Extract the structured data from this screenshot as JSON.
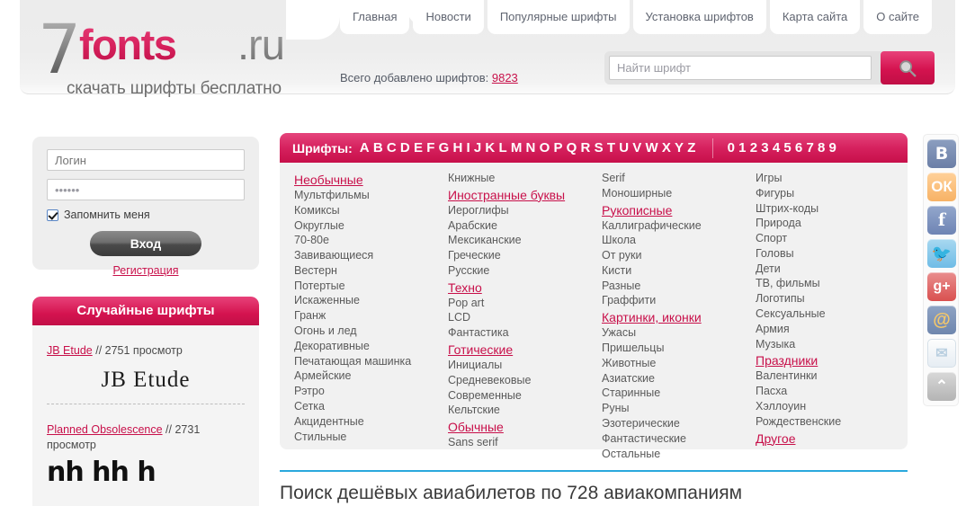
{
  "site": {
    "logo_seven": "7",
    "logo_fonts": "fonts",
    "logo_ru": ".ru",
    "tagline": "скачать шрифты бесплатно"
  },
  "nav": {
    "items": [
      {
        "label": "Главная"
      },
      {
        "label": "Новости"
      },
      {
        "label": "Популярные шрифты"
      },
      {
        "label": "Установка шрифтов"
      },
      {
        "label": "Карта сайта"
      },
      {
        "label": "О сайте"
      }
    ]
  },
  "counter": {
    "label": "Всего добавлено шрифтов:",
    "value": "9823"
  },
  "search": {
    "placeholder": "Найти шрифт",
    "value": "",
    "icon": "search-icon"
  },
  "login": {
    "username_placeholder": "Логин",
    "username_value": "",
    "password_value": "••••••",
    "remember_label": "Запомнить меня",
    "remember_checked": true,
    "submit_label": "Вход",
    "register_label": "Регистрация"
  },
  "random_fonts": {
    "title": "Случайные шрифты",
    "items": [
      {
        "name": "JB Etude",
        "sep": "//",
        "views": "2751 просмотр",
        "preview": "JB Etude"
      },
      {
        "name": "Planned Obsolescence",
        "sep": "//",
        "views": "2731 просмотр",
        "preview": "nh hh h"
      }
    ]
  },
  "alphabet_bar": {
    "label": "Шрифты:",
    "letters": [
      "A",
      "B",
      "C",
      "D",
      "E",
      "F",
      "G",
      "H",
      "I",
      "J",
      "K",
      "L",
      "M",
      "N",
      "O",
      "P",
      "Q",
      "R",
      "S",
      "T",
      "U",
      "V",
      "W",
      "X",
      "Y",
      "Z"
    ],
    "digits": [
      "0",
      "1",
      "2",
      "3",
      "4",
      "5",
      "6",
      "7",
      "8",
      "9"
    ]
  },
  "categories": {
    "columns": [
      {
        "items": [
          {
            "label": "Необычные",
            "head": true
          },
          {
            "label": "Мультфильмы",
            "head": false
          },
          {
            "label": "Комиксы",
            "head": false
          },
          {
            "label": "Округлые",
            "head": false
          },
          {
            "label": "70-80е",
            "head": false
          },
          {
            "label": "Завивающиеся",
            "head": false
          },
          {
            "label": "Вестерн",
            "head": false
          },
          {
            "label": "Потертые",
            "head": false
          },
          {
            "label": "Искаженные",
            "head": false
          },
          {
            "label": "Гранж",
            "head": false
          },
          {
            "label": "Огонь и лед",
            "head": false
          },
          {
            "label": "Декоративные",
            "head": false
          },
          {
            "label": "Печатающая машинка",
            "head": false
          },
          {
            "label": "Армейские",
            "head": false
          },
          {
            "label": "Рэтро",
            "head": false
          },
          {
            "label": "Сетка",
            "head": false
          },
          {
            "label": "Акцидентные",
            "head": false
          },
          {
            "label": "Стильные",
            "head": false
          }
        ]
      },
      {
        "items": [
          {
            "label": "Книжные",
            "head": false
          },
          {
            "label": "Иностранные буквы",
            "head": true
          },
          {
            "label": "Иероглифы",
            "head": false
          },
          {
            "label": "Арабские",
            "head": false
          },
          {
            "label": "Мексиканские",
            "head": false
          },
          {
            "label": "Греческие",
            "head": false
          },
          {
            "label": "Русские",
            "head": false
          },
          {
            "label": "Техно",
            "head": true
          },
          {
            "label": "Pop art",
            "head": false
          },
          {
            "label": "LCD",
            "head": false
          },
          {
            "label": "Фантастика",
            "head": false
          },
          {
            "label": "Готические",
            "head": true
          },
          {
            "label": "Инициалы",
            "head": false
          },
          {
            "label": "Средневековые",
            "head": false
          },
          {
            "label": "Современные",
            "head": false
          },
          {
            "label": "Кельтские",
            "head": false
          },
          {
            "label": "Обычные",
            "head": true
          },
          {
            "label": "Sans serif",
            "head": false
          }
        ]
      },
      {
        "items": [
          {
            "label": "Serif",
            "head": false
          },
          {
            "label": "Моноширные",
            "head": false
          },
          {
            "label": "Рукописные",
            "head": true
          },
          {
            "label": "Каллиграфические",
            "head": false
          },
          {
            "label": "Школа",
            "head": false
          },
          {
            "label": "От руки",
            "head": false
          },
          {
            "label": "Кисти",
            "head": false
          },
          {
            "label": "Разные",
            "head": false
          },
          {
            "label": "Граффити",
            "head": false
          },
          {
            "label": "Картинки, иконки",
            "head": true
          },
          {
            "label": "Ужасы",
            "head": false
          },
          {
            "label": "Пришельцы",
            "head": false
          },
          {
            "label": "Животные",
            "head": false
          },
          {
            "label": "Азиатские",
            "head": false
          },
          {
            "label": "Старинные",
            "head": false
          },
          {
            "label": "Руны",
            "head": false
          },
          {
            "label": "Эзотерические",
            "head": false
          },
          {
            "label": "Фантастические",
            "head": false
          },
          {
            "label": "Остальные",
            "head": false
          }
        ]
      },
      {
        "items": [
          {
            "label": "Игры",
            "head": false
          },
          {
            "label": "Фигуры",
            "head": false
          },
          {
            "label": "Штрих-коды",
            "head": false
          },
          {
            "label": "Природа",
            "head": false
          },
          {
            "label": "Спорт",
            "head": false
          },
          {
            "label": "Головы",
            "head": false
          },
          {
            "label": "Дети",
            "head": false
          },
          {
            "label": "ТВ, фильмы",
            "head": false
          },
          {
            "label": "Логотипы",
            "head": false
          },
          {
            "label": "Сексуальные",
            "head": false
          },
          {
            "label": "Армия",
            "head": false
          },
          {
            "label": "Музыка",
            "head": false
          },
          {
            "label": "Праздники",
            "head": true
          },
          {
            "label": "Валентинки",
            "head": false
          },
          {
            "label": "Пасха",
            "head": false
          },
          {
            "label": "Хэллоуин",
            "head": false
          },
          {
            "label": "Рождественские",
            "head": false
          },
          {
            "label": "Другое",
            "head": true
          }
        ]
      }
    ]
  },
  "social": {
    "items": [
      {
        "name": "vk-icon",
        "glyph": "B",
        "cls": "s-vk"
      },
      {
        "name": "odnoklassniki-icon",
        "glyph": "ОК",
        "cls": "s-ok"
      },
      {
        "name": "facebook-icon",
        "glyph": "f",
        "cls": "s-fb"
      },
      {
        "name": "twitter-icon",
        "glyph": "🐦",
        "cls": "s-tw"
      },
      {
        "name": "google-plus-icon",
        "glyph": "g+",
        "cls": "s-gp"
      },
      {
        "name": "mailru-icon",
        "glyph": "@",
        "cls": "s-mr"
      },
      {
        "name": "email-icon",
        "glyph": "✉",
        "cls": "s-ml"
      },
      {
        "name": "scroll-to-top-icon",
        "glyph": "⌃",
        "cls": "s-up"
      }
    ]
  },
  "banner": {
    "title": "Поиск дешёвых авиабилетов по 728 авиакомпаниям"
  },
  "colors": {
    "accent": "#c8104a",
    "accent_light": "#e5457c",
    "panel": "#f1f1f1",
    "banner_rule": "#2aa8dd"
  }
}
